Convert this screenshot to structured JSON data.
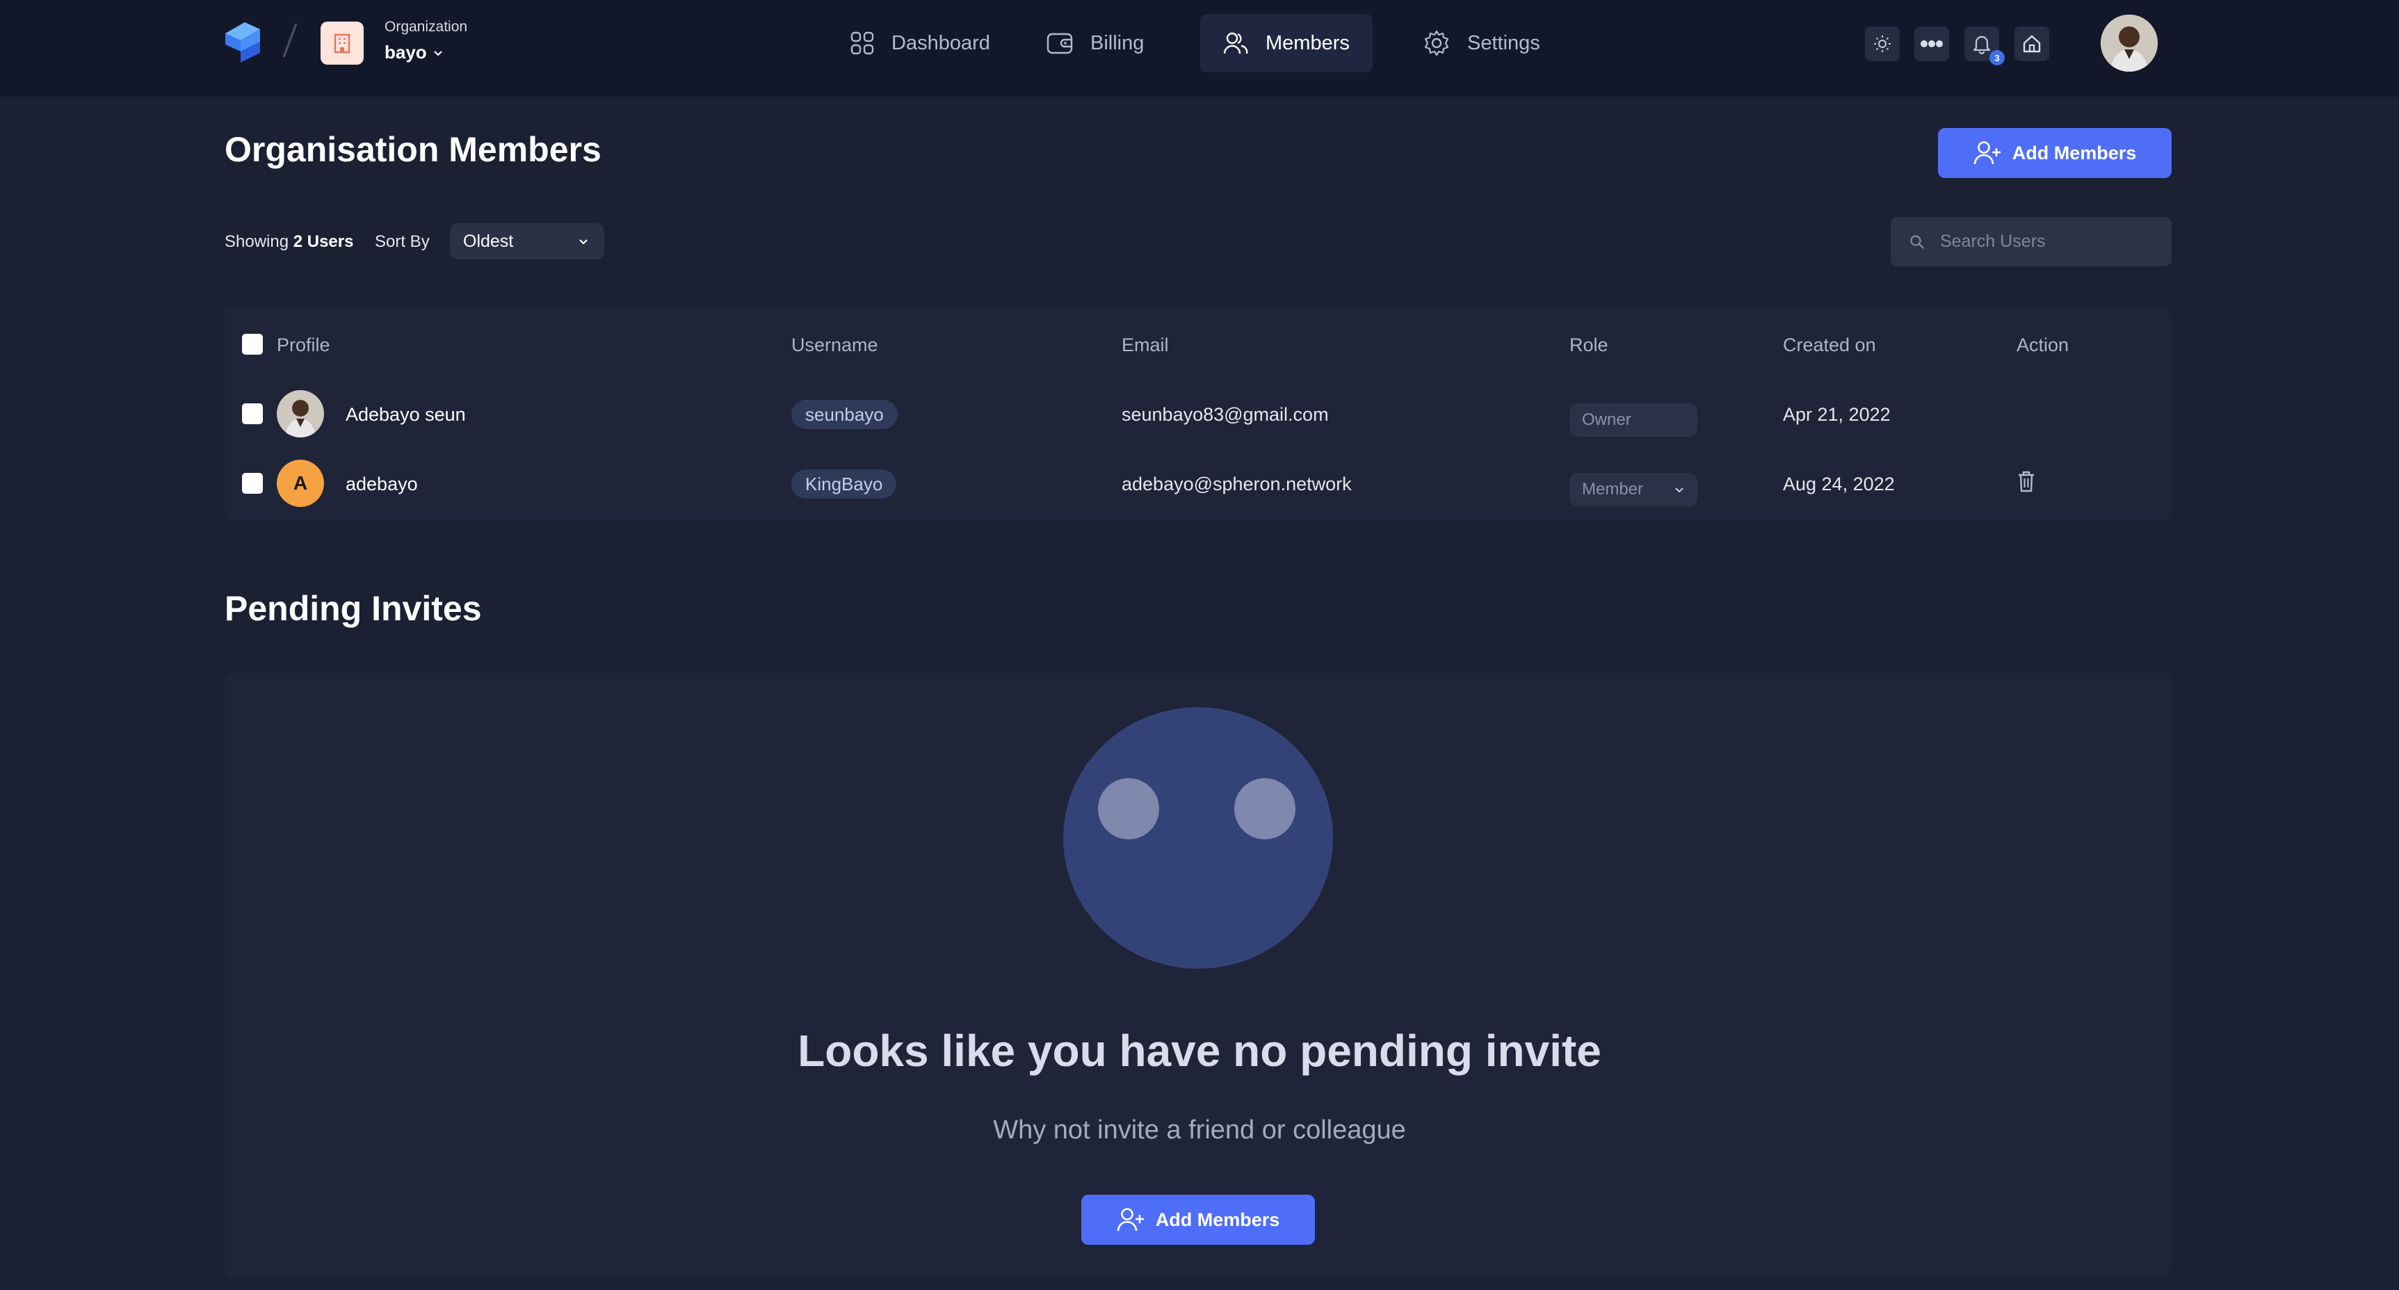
{
  "org": {
    "caption": "Organization",
    "name": "bayo"
  },
  "nav": {
    "dashboard": "Dashboard",
    "billing": "Billing",
    "members": "Members",
    "settings": "Settings"
  },
  "toolbar": {
    "notification_count": "3"
  },
  "page": {
    "title": "Organisation Members",
    "add_members_label": "Add Members",
    "showing_prefix": "Showing",
    "showing_count": "2 Users",
    "sort_label": "Sort By",
    "sort_value": "Oldest",
    "search_placeholder": "Search Users"
  },
  "table": {
    "headers": {
      "profile": "Profile",
      "username": "Username",
      "email": "Email",
      "role": "Role",
      "created": "Created on",
      "action": "Action"
    },
    "rows": [
      {
        "name": "Adebayo seun",
        "username": "seunbayo",
        "email": "seunbayo83@gmail.com",
        "role": "Owner",
        "created": "Apr 21, 2022",
        "avatar_letter": ""
      },
      {
        "name": "adebayo",
        "username": "KingBayo",
        "email": "adebayo@spheron.network",
        "role": "Member",
        "created": "Aug 24, 2022",
        "avatar_letter": "A"
      }
    ]
  },
  "pending": {
    "title": "Pending Invites",
    "empty_title": "Looks like you have no pending invite",
    "empty_subtitle": "Why not invite a friend or colleague",
    "add_members_label": "Add Members"
  },
  "colors": {
    "background": "#1b2033",
    "topbar": "#121829",
    "accent": "#4f6ef7",
    "card": "#1f2438"
  }
}
